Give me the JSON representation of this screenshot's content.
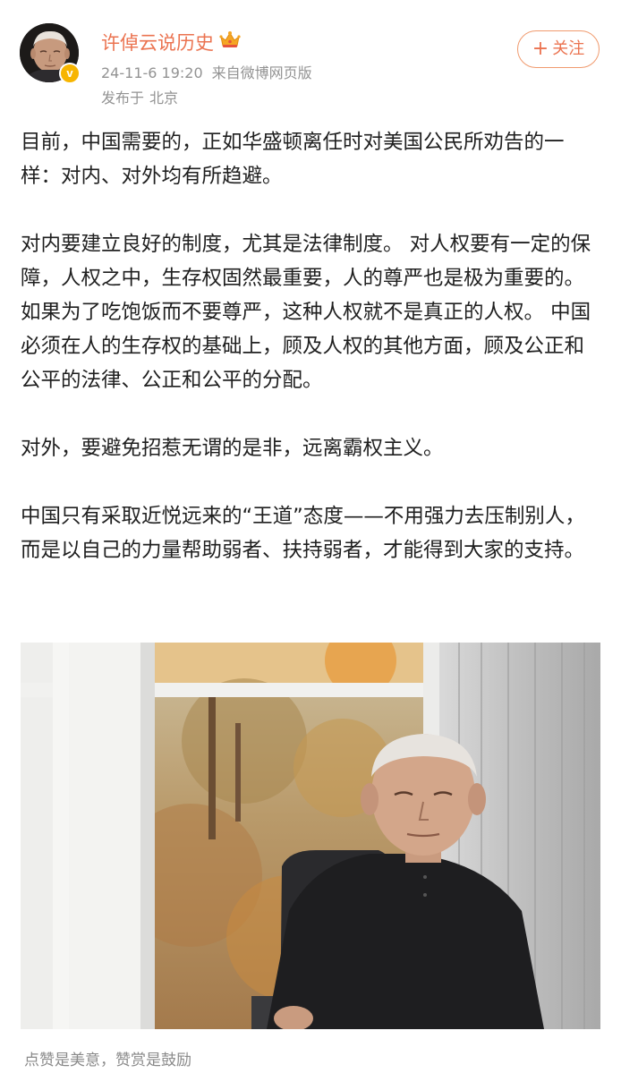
{
  "post": {
    "author": {
      "name": "许倬云说历史",
      "avatar_icon": "avatar-elderly-man",
      "verified_icon": "verified-yellow-v",
      "vip_icon": "crown-icon"
    },
    "timestamp": "24-11-6 19:20",
    "source": "来自微博网页版",
    "location_label": "发布于",
    "location": "北京",
    "follow_label": "关注",
    "follow_plus": "+",
    "paragraphs": [
      "目前，中国需要的，正如华盛顿离任时对美国公民所劝告的一样：对内、对外均有所趋避。",
      "对内要建立良好的制度，尤其是法律制度。 对人权要有一定的保障，人权之中，生存权固然最重要，人的尊严也是极为重要的。 如果为了吃饱饭而不要尊严，这种人权就不是真正的人权。 中国必须在人的生存权的基础上，顾及人权的其他方面，顾及公正和公平的法律、公正和公平的分配。",
      "对外，要避免招惹无谓的是非，远离霸权主义。",
      "中国只有采取近悦远来的“王道”态度——不用强力去压制别人，而是以自己的力量帮助弱者、扶持弱者，才能得到大家的支持。"
    ],
    "footer_note": "点赞是美意，赞赏是鼓励"
  },
  "colors": {
    "username": "#eb7350",
    "meta": "#939393",
    "body_text": "#1f1f1f",
    "follow_border": "#f09a6e",
    "verified": "#f7b500"
  }
}
